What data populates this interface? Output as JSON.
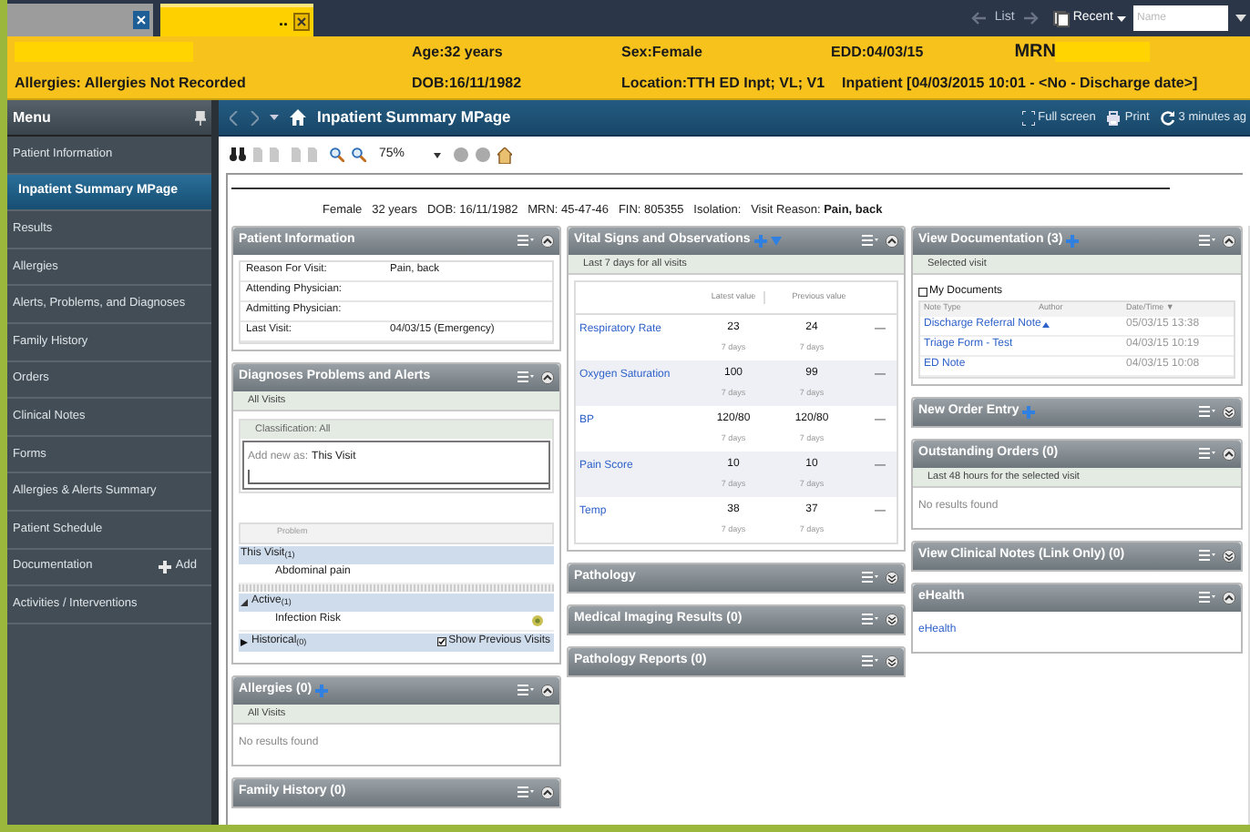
{
  "tabs": [
    {
      "selected": false
    },
    {
      "label": "..",
      "selected": true
    }
  ],
  "header_nav": {
    "list": "List",
    "recent": "Recent",
    "name_placeholder": "Name"
  },
  "banner": {
    "age": "Age:32 years",
    "sex": "Sex:Female",
    "edd": "EDD:04/03/15",
    "mrn": "MRN",
    "allergies": "Allergies: Allergies Not Recorded",
    "dob": "DOB:16/11/1982",
    "location": "Location:TTH ED Inpt; VL; V1",
    "encounter": "Inpatient [04/03/2015 10:01 - <No - Discharge date>]"
  },
  "menu": {
    "title": "Menu",
    "items": [
      {
        "label": "Patient Information",
        "selected": false
      },
      {
        "label": "Inpatient Summary MPage",
        "selected": true
      },
      {
        "label": "Results",
        "selected": false
      },
      {
        "label": "Allergies",
        "selected": false
      },
      {
        "label": "Alerts, Problems, and Diagnoses",
        "selected": false
      },
      {
        "label": "Family History",
        "selected": false
      },
      {
        "label": "Orders",
        "selected": false
      },
      {
        "label": "Clinical Notes",
        "selected": false
      },
      {
        "label": "Forms",
        "selected": false
      },
      {
        "label": "Allergies & Alerts Summary",
        "selected": false
      },
      {
        "label": "Patient Schedule",
        "selected": false
      },
      {
        "label": "Documentation",
        "selected": false,
        "action": "Add"
      },
      {
        "label": "Activities / Interventions",
        "selected": false
      }
    ]
  },
  "page_toolbar": {
    "title": "Inpatient Summary MPage",
    "full_screen": "Full screen",
    "print": "Print",
    "refresh": "3 minutes ag"
  },
  "viewer": {
    "zoom": "75%"
  },
  "patient_line": "Female   32 years   DOB: 16/11/1982   MRN: 45-47-46   FIN: 805355   Isolation:   Visit Reason: **Pain, back**",
  "columns": [
    [
      {
        "kind": "info",
        "title": "Patient Information",
        "expanded": true,
        "rows": [
          [
            "Reason For Visit:",
            "Pain, back"
          ],
          [
            "Attending Physician:"
          ],
          [
            "Admitting Physician:"
          ],
          [
            "Last Visit:",
            "04/03/15 (Emergency)"
          ]
        ]
      },
      {
        "kind": "diagnoses",
        "title": "Diagnoses Problems and Alerts",
        "expanded": true,
        "subheader": "All Visits",
        "classification": "Classification: All",
        "add_label": "Add new as:",
        "add_value": "This Visit",
        "column": "Problem",
        "groups": [
          {
            "label": "This Visit$_{(1)}$",
            "items": [
              {
                "label": "Abdominal pain",
                "alert": false
              }
            ]
          },
          {
            "label": "Active$_{(1)}$",
            "expanded": true,
            "items": [
              {
                "label": "Infection Risk",
                "alert": true
              }
            ]
          },
          {
            "label": "Historical$_{(0)}$",
            "expanded": false,
            "option": "Show Previous Visits",
            "checked": true
          }
        ]
      },
      {
        "kind": "empty",
        "title": "Allergies (0)",
        "add": true,
        "expanded": true,
        "subheader": "All Visits",
        "message": "No results found"
      },
      {
        "kind": "none",
        "title": "Family History (0)",
        "expanded": true
      }
    ],
    [
      {
        "kind": "vitals",
        "title": "Vital Signs and Observations",
        "add": true,
        "filter": true,
        "expanded": true,
        "subheader": "Last 7 days for all visits",
        "headers": [
          "Latest value",
          "Previous value"
        ],
        "rows": [
          {
            "name": "Respiratory Rate",
            "latest": "23",
            "latest_when": "7 days",
            "previous": "24",
            "previous_when": "7 days",
            "trend": "—"
          },
          {
            "name": "Oxygen Saturation",
            "latest": "100",
            "latest_when": "7 days",
            "previous": "99",
            "previous_when": "7 days",
            "trend": "—"
          },
          {
            "name": "BP",
            "latest": "120/80",
            "latest_when": "7 days",
            "previous": "120/80",
            "previous_when": "7 days",
            "trend": "—"
          },
          {
            "name": "Pain Score",
            "latest": "10",
            "latest_when": "7 days",
            "previous": "10",
            "previous_when": "7 days",
            "trend": "—"
          },
          {
            "name": "Temp",
            "latest": "38",
            "latest_when": "7 days",
            "previous": "37",
            "previous_when": "7 days",
            "trend": "—"
          }
        ]
      },
      {
        "kind": "none",
        "title": "Pathology",
        "expanded": false
      },
      {
        "kind": "none",
        "title": "Medical Imaging Results (0)",
        "expanded": false
      },
      {
        "kind": "none",
        "title": "Pathology Reports (0)",
        "expanded": false
      }
    ],
    [
      {
        "kind": "documents",
        "title": "View Documentation (3)",
        "add": true,
        "expanded": true,
        "subheader": "Selected visit",
        "filter_label": "My Documents",
        "filter_checked": false,
        "headers": [
          "Note Type",
          "Author",
          "Date/Time ▼"
        ],
        "rows": [
          {
            "name": "Discharge Referral Note",
            "flag": true,
            "date": "05/03/15 13:38"
          },
          {
            "name": "Triage Form - Test",
            "flag": false,
            "date": "04/03/15 10:19"
          },
          {
            "name": "ED Note",
            "flag": false,
            "date": "04/03/15 10:08"
          }
        ]
      },
      {
        "kind": "none",
        "title": "New Order Entry",
        "add": true,
        "expanded": false
      },
      {
        "kind": "empty",
        "title": "Outstanding Orders (0)",
        "expanded": true,
        "subheader": "Last 48 hours for the selected visit",
        "message": "No results found"
      },
      {
        "kind": "none",
        "title": "View Clinical Notes (Link Only) (0)",
        "expanded": false
      },
      {
        "kind": "links",
        "title": "eHealth",
        "expanded": true,
        "links": [
          "eHealth"
        ]
      }
    ]
  ]
}
